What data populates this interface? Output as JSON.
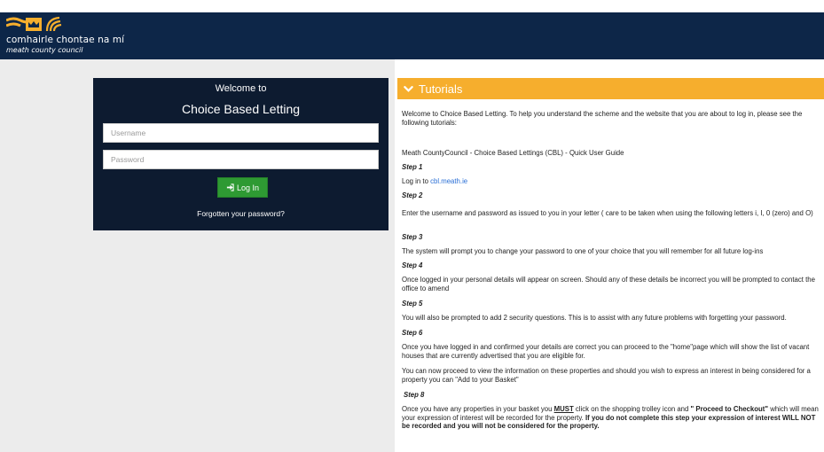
{
  "header": {
    "council_name_irish": "comhairle chontae na mí",
    "council_name_english": "meath county council"
  },
  "login": {
    "welcome": "Welcome to",
    "title": "Choice Based Letting",
    "username_placeholder": "Username",
    "password_placeholder": "Password",
    "login_button": "Log In",
    "forgot_link": "Forgotten your password?"
  },
  "tutorials": {
    "title": "Tutorials",
    "intro": "Welcome to Choice Based Letting. To help you understand the scheme and the website that you are about to log in, please see the following tutorials:",
    "guide_title": "Meath CountyCouncil - Choice Based Lettings (CBL) - Quick User Guide",
    "step1": "Step 1",
    "step1_prefix": "Log in to ",
    "step1_link": "cbl.meath.ie",
    "step2": "Step 2",
    "step2_text": "Enter the username and password as issued to you in your letter ( care to be taken when using the following letters i, I, 0 (zero) and O)",
    "step3": "Step 3",
    "step3_text": "The system will prompt you to change your password to one of your choice that you will remember for all future log-ins",
    "step4": "Step 4",
    "step4_text": "Once logged in your personal details will appear on screen. Should any of these details be incorrect you will be prompted to contact the office to amend",
    "step5": "Step 5",
    "step5_text": "You will also be prompted to add 2 security questions.  This is to assist with any future problems with forgetting your password.",
    "step6": "Step 6",
    "step6_text": "Once you have logged in and confirmed your details are correct you can proceed to the \"home\"page which will show the list of vacant houses that are currently advertised that you are eligible for.",
    "step6_text2": "You can now proceed to view the information on these properties and should you wish to express an interest in being considered for a  property  you can \"Add to your Basket\"",
    "step8": "Step 8",
    "step8_a": "Once  you have any properties in your basket you ",
    "step8_must": "MUST",
    "step8_b": " click on the shopping trolley icon and ",
    "step8_checkout": "\" Proceed to Checkout\"",
    "step8_c": " which will mean your expression of interest will be recorded for the property. ",
    "step8_warning": "If you do not complete this step your expression of interest WILL NOT be recorded and you will not be considered for the property."
  },
  "colors": {
    "header_bg": "#0d2648",
    "login_bg": "#0d1b30",
    "accent_orange": "#f6ae2d",
    "button_green": "#2e9a33",
    "link_blue": "#2a6fd6"
  }
}
